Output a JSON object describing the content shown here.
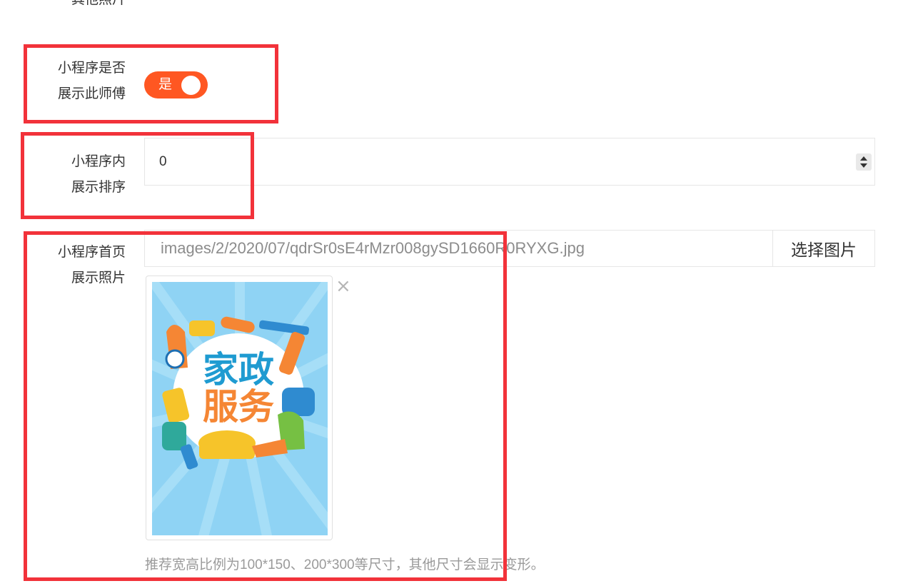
{
  "previous_field": {
    "label_line2": "其他照片"
  },
  "show_toggle": {
    "label_line1": "小程序是否",
    "label_line2": "展示此师傅",
    "state_text": "是",
    "checked": true,
    "color": "#ff5722"
  },
  "sort_field": {
    "label_line1": "小程序内",
    "label_line2": "展示排序",
    "value": "0"
  },
  "photo_field": {
    "label_line1": "小程序首页",
    "label_line2": "展示照片",
    "path_value": "images/2/2020/07/qdrSr0sE4rMzr008gySD1660R0RYXG.jpg",
    "choose_button": "选择图片",
    "remove_icon": "close-icon",
    "thumbnail": {
      "title_line1": "家政",
      "title_line2": "服务",
      "bg_color": "#8fd3f4"
    },
    "hint": "推荐宽高比例为100*150、200*300等尺寸，其他尺寸会显示变形。"
  },
  "highlight_color": "#f2323a"
}
